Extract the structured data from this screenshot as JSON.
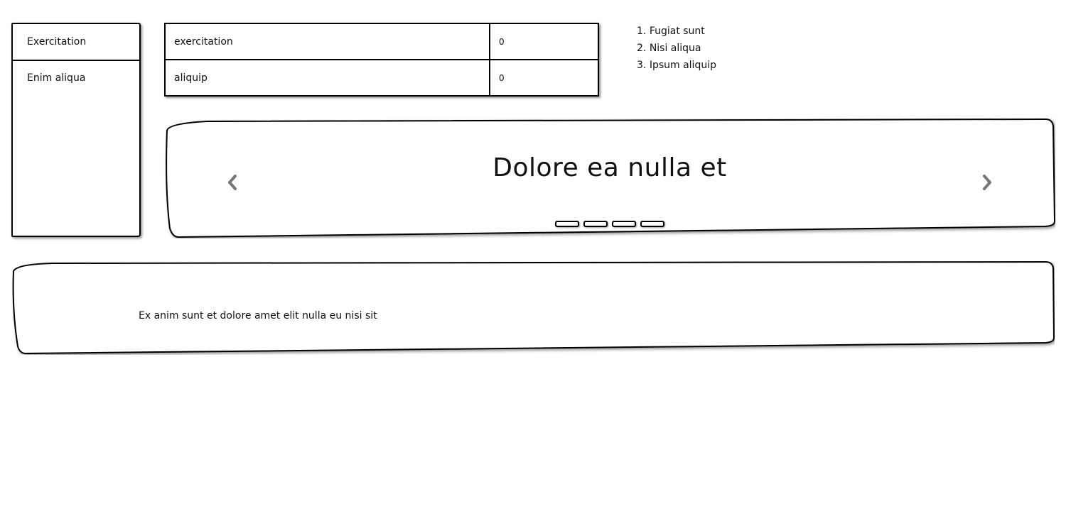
{
  "sidebar": {
    "items": [
      {
        "label": "Exercitation"
      },
      {
        "label": "Enim aliqua"
      }
    ]
  },
  "table": {
    "rows": [
      {
        "name": "exercitation",
        "value": "0"
      },
      {
        "name": "aliquip",
        "value": "0"
      }
    ]
  },
  "ordered_list": {
    "items": [
      {
        "marker": "1.",
        "text": "Fugiat sunt"
      },
      {
        "marker": "2.",
        "text": "Nisi aliqua"
      },
      {
        "marker": "3.",
        "text": "Ipsum aliquip"
      }
    ]
  },
  "carousel": {
    "title": "Dolore ea nulla et",
    "prev_icon": "chevron-left-icon",
    "next_icon": "chevron-right-icon",
    "slide_count": 4,
    "arrow_color": "#777777"
  },
  "text_panel": {
    "text": "Ex anim sunt et dolore amet elit nulla eu nisi sit"
  }
}
